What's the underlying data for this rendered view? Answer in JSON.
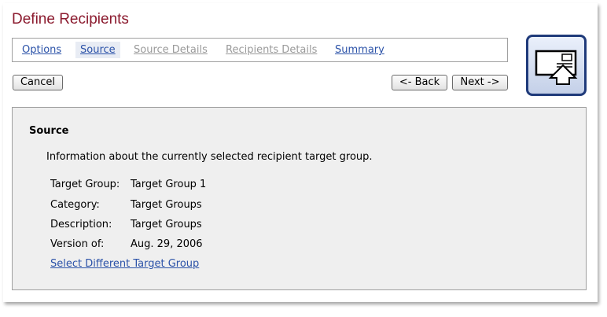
{
  "page": {
    "title": "Define Recipients"
  },
  "tabs": [
    {
      "label": "Options",
      "state": "enabled"
    },
    {
      "label": "Source",
      "state": "active"
    },
    {
      "label": "Source Details",
      "state": "disabled"
    },
    {
      "label": "Recipients Details",
      "state": "disabled"
    },
    {
      "label": "Summary",
      "state": "enabled"
    }
  ],
  "buttons": {
    "cancel": "Cancel",
    "back": "<- Back",
    "next": "Next ->"
  },
  "icon": {
    "name": "define-recipients-wizard-icon"
  },
  "section": {
    "title": "Source",
    "description": "Information about the currently selected recipient target group.",
    "fields": [
      {
        "label": "Target Group:",
        "value": "Target Group 1"
      },
      {
        "label": "Category:",
        "value": "Target Groups"
      },
      {
        "label": "Description:",
        "value": "Target Groups"
      },
      {
        "label": "Version of:",
        "value": "Aug. 29, 2006"
      }
    ],
    "link": "Select Different Target Group"
  },
  "colors": {
    "title": "#8b1a2e",
    "link": "#2b52a8",
    "disabled_tab": "#9a9a9a",
    "content_bg": "#efefef",
    "icon_border": "#1f3a7a"
  }
}
